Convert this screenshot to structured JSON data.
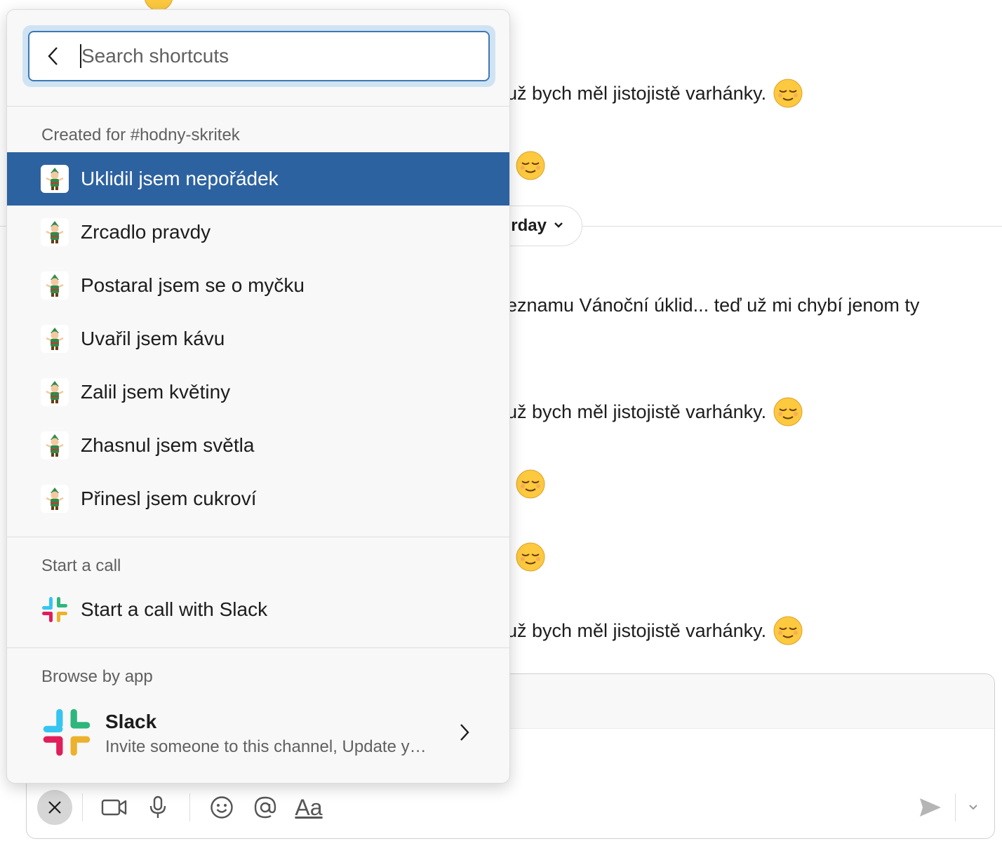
{
  "chat": {
    "messages": [
      {
        "text": "už bych měl jistojistě varhánky."
      },
      {
        "text": "eznamu Vánoční úklid... teď už mi chybí jenom ty"
      },
      {
        "text": "už bych měl jistojistě varhánky."
      },
      {
        "text": "už bych měl jistojistě varhánky."
      }
    ],
    "day_divider_label": "rday"
  },
  "popup": {
    "search": {
      "placeholder": "Search shortcuts",
      "value": ""
    },
    "sections": {
      "channel": {
        "heading": "Created for #hodny-skritek",
        "items": [
          {
            "label": "Uklidil jsem nepořádek",
            "icon": "elf-icon",
            "selected": true
          },
          {
            "label": "Zrcadlo pravdy",
            "icon": "elf-icon"
          },
          {
            "label": "Postaral jsem se o myčku",
            "icon": "elf-icon"
          },
          {
            "label": "Uvařil jsem kávu",
            "icon": "elf-icon"
          },
          {
            "label": "Zalil jsem květiny",
            "icon": "elf-icon"
          },
          {
            "label": "Zhasnul jsem světla",
            "icon": "elf-icon"
          },
          {
            "label": "Přinesl jsem cukroví",
            "icon": "elf-icon"
          }
        ]
      },
      "call": {
        "heading": "Start a call",
        "items": [
          {
            "label": "Start a call with Slack",
            "icon": "slack-logo-icon"
          }
        ]
      },
      "browse": {
        "heading": "Browse by app",
        "app_name": "Slack",
        "app_description": "Invite someone to this channel, Update y…",
        "icon": "slack-logo-icon"
      }
    }
  },
  "composer": {
    "toolbar": {
      "close_icon": "close-icon",
      "video_icon": "video-icon",
      "mic_icon": "microphone-icon",
      "emoji_icon": "emoji-icon",
      "mention_icon": "at-icon",
      "format_label": "Aa",
      "send_icon": "send-icon",
      "send_options_icon": "chevron-down-icon"
    }
  },
  "colors": {
    "selected_bg": "#2d62a0",
    "search_focus": "#3f78b3",
    "slack_blue": "#36c5f0",
    "slack_green": "#2eb67d",
    "slack_red": "#e01e5a",
    "slack_yellow": "#ecb22e"
  }
}
